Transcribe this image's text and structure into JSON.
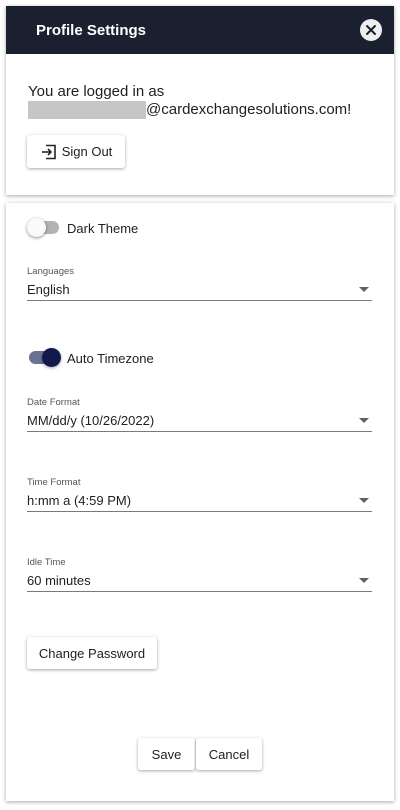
{
  "header": {
    "title": "Profile Settings",
    "close_icon": "close-circle-icon"
  },
  "account": {
    "logged_in_prefix": "You are logged in as",
    "email_suffix": "@cardexchangesolutions.com!",
    "sign_out_label": "Sign Out",
    "sign_out_icon": "sign-out-icon"
  },
  "settings": {
    "dark_theme": {
      "label": "Dark Theme",
      "enabled": false
    },
    "languages": {
      "label": "Languages",
      "value": "English"
    },
    "auto_timezone": {
      "label": "Auto Timezone",
      "enabled": true
    },
    "date_format": {
      "label": "Date Format",
      "value": "MM/dd/y (10/26/2022)"
    },
    "time_format": {
      "label": "Time Format",
      "value": "h:mm a (4:59 PM)"
    },
    "idle_time": {
      "label": "Idle Time",
      "value": "60 minutes"
    },
    "change_password_label": "Change Password"
  },
  "actions": {
    "save_label": "Save",
    "cancel_label": "Cancel"
  },
  "colors": {
    "header_bg": "#1b2030",
    "toggle_on_thumb": "#121a4d",
    "toggle_on_track": "#6b7191",
    "toggle_off_track": "#b3b3b3"
  }
}
